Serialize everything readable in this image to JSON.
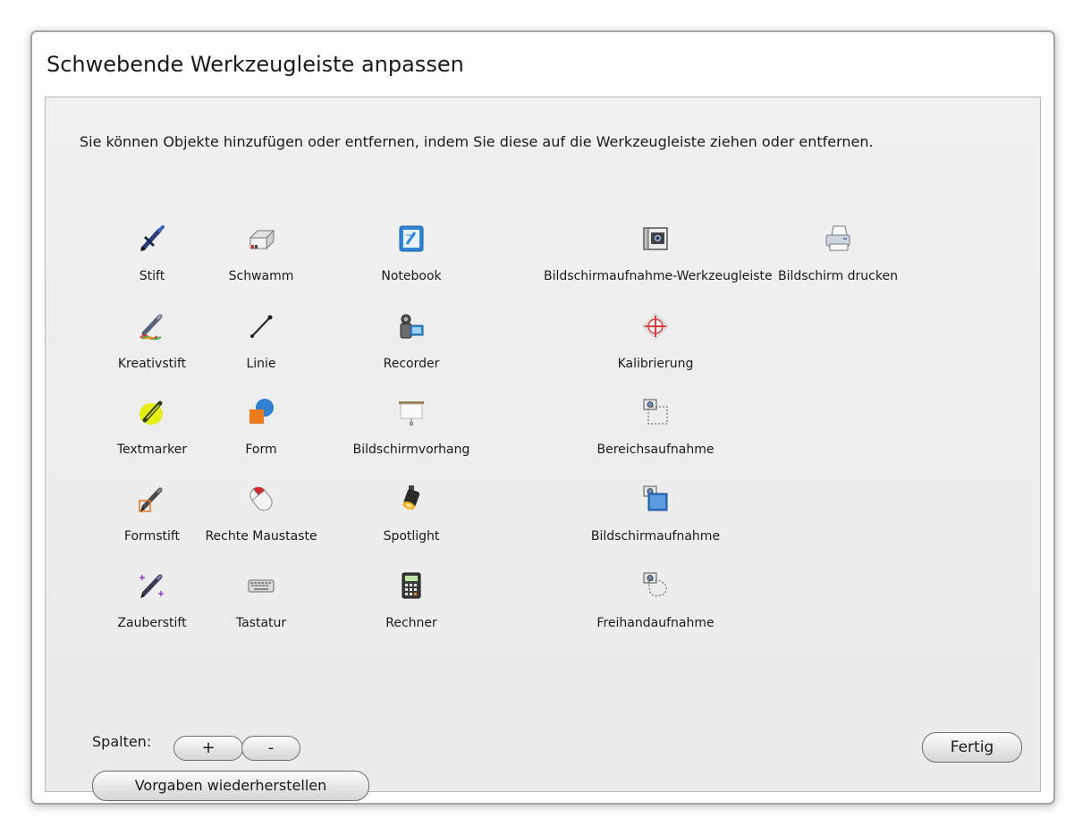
{
  "dialog": {
    "title": "Schwebende Werkzeugleiste anpassen",
    "instruction": "Sie können Objekte hinzufügen oder entfernen, indem Sie diese auf die Werkzeugleiste ziehen oder entfernen."
  },
  "tools": {
    "stift": "Stift",
    "schwamm": "Schwamm",
    "notebook": "Notebook",
    "bildschirmaufnahme_werkzeugleiste": "Bildschirmaufnahme-Werkzeugleiste",
    "bildschirm_drucken": "Bildschirm drucken",
    "kreativstift": "Kreativstift",
    "linie": "Linie",
    "recorder": "Recorder",
    "kalibrierung": "Kalibrierung",
    "textmarker": "Textmarker",
    "form": "Form",
    "bildschirmvorhang": "Bildschirmvorhang",
    "bereichsaufnahme": "Bereichsaufnahme",
    "formstift": "Formstift",
    "rechte_maustaste": "Rechte Maustaste",
    "spotlight": "Spotlight",
    "bildschirmaufnahme": "Bildschirmaufnahme",
    "zauberstift": "Zauberstift",
    "tastatur": "Tastatur",
    "rechner": "Rechner",
    "freihandaufnahme": "Freihandaufnahme"
  },
  "footer": {
    "spalten_label": "Spalten:",
    "plus_label": "+",
    "minus_label": "-",
    "reset_label": "Vorgaben wiederherstellen",
    "done_label": "Fertig"
  }
}
